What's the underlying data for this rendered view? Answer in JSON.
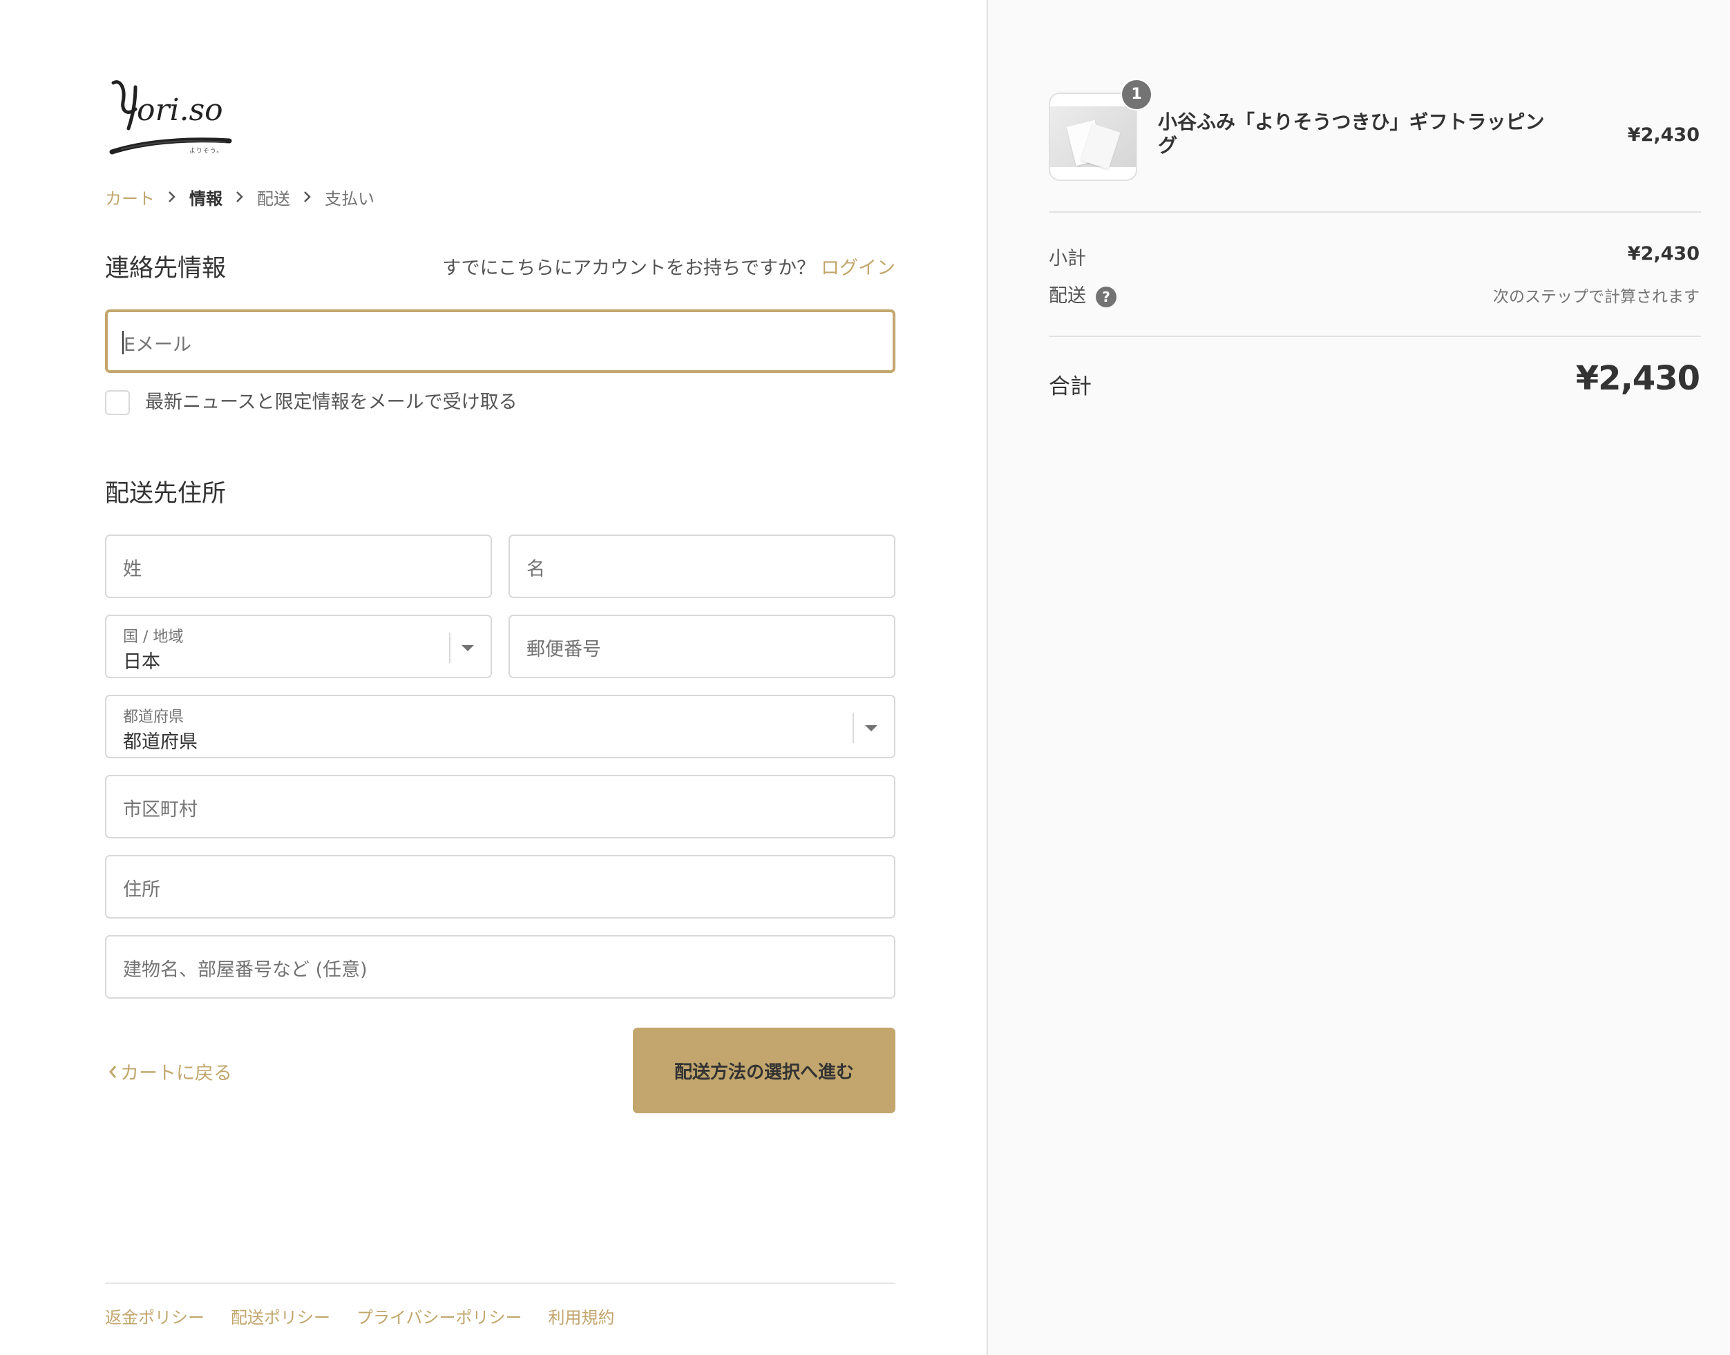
{
  "logo": {
    "text": "Yori.so",
    "tagline": "よりそう。"
  },
  "breadcrumb": {
    "cart": "カート",
    "info": "情報",
    "shipping": "配送",
    "payment": "支払い"
  },
  "contact": {
    "title": "連絡先情報",
    "have_account": "すでにこちらにアカウントをお持ちですか？",
    "login": "ログイン",
    "email_placeholder": "Eメール",
    "newsletter_label": "最新ニュースと限定情報をメールで受け取る"
  },
  "shipping_address": {
    "title": "配送先住所",
    "last_name_placeholder": "姓",
    "first_name_placeholder": "名",
    "country_label": "国 / 地域",
    "country_value": "日本",
    "postal_placeholder": "郵便番号",
    "prefecture_label": "都道府県",
    "prefecture_value": "都道府県",
    "city_placeholder": "市区町村",
    "address_placeholder": "住所",
    "building_placeholder": "建物名、部屋番号など (任意)"
  },
  "actions": {
    "back_label": "カートに戻る",
    "continue_label": "配送方法の選択へ進む"
  },
  "footer": {
    "refund": "返金ポリシー",
    "shipping": "配送ポリシー",
    "privacy": "プライバシーポリシー",
    "terms": "利用規約"
  },
  "summary": {
    "product_name": "小谷ふみ「よりそうつきひ」ギフトラッピング",
    "product_price": "¥2,430",
    "quantity": "1",
    "subtotal_label": "小計",
    "subtotal_value": "¥2,430",
    "shipping_label": "配送",
    "shipping_value": "次のステップで計算されます",
    "total_label": "合計",
    "total_value": "¥2,430"
  },
  "colors": {
    "accent": "#c2a66d",
    "text": "#333333",
    "muted": "#737373",
    "border": "#d9d9d9",
    "sidebar_bg": "#fafafa"
  }
}
